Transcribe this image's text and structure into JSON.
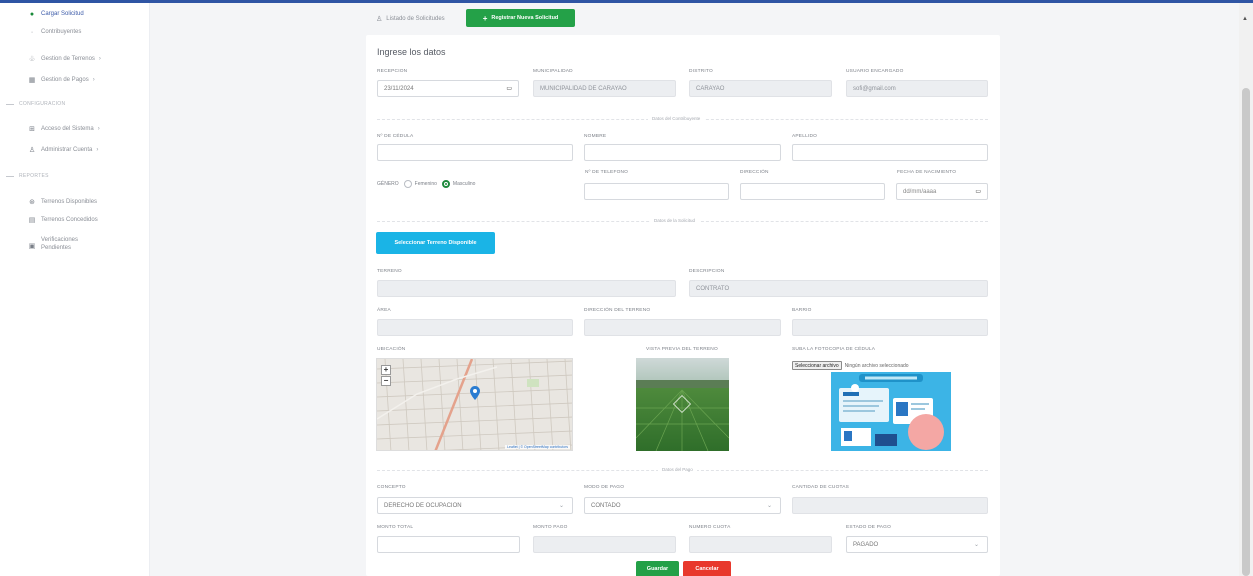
{
  "sidebar": {
    "items": [
      {
        "label": "Cargar Solicitud",
        "icon": "dot-icon"
      },
      {
        "label": "Contribuyentes",
        "icon": "dot-icon"
      },
      {
        "label": "Gestion de Terrenos",
        "icon": "tree-icon",
        "arrow": "›"
      },
      {
        "label": "Gestion de Pagos",
        "icon": "card-icon",
        "arrow": "›"
      }
    ],
    "section_config": "CONFIGURACION",
    "config_items": [
      {
        "label": "Acceso del Sistema",
        "icon": "grid-icon",
        "arrow": "›"
      },
      {
        "label": "Administrar Cuenta",
        "icon": "user-icon",
        "arrow": "›"
      }
    ],
    "section_reports": "REPORTES",
    "report_items": [
      {
        "label": "Terrenos Disponibles",
        "icon": "grid-icon"
      },
      {
        "label": "Terrenos Concedidos",
        "icon": "grid-icon"
      },
      {
        "label": "Verificaciones Pendientes",
        "icon": "doc-icon"
      }
    ]
  },
  "tabs": {
    "list_label": "Listado de Solicitudes",
    "new_label": "Registrar Nueva Solicitud"
  },
  "form": {
    "title": "Ingrese los datos",
    "recepcion_label": "RECEPCION",
    "recepcion_value": "23/11/2024",
    "municipalidad_label": "MUNICIPALIDAD",
    "municipalidad_value": "MUNICIPALIDAD DE CARAYAO",
    "distrito_label": "DISTRITO",
    "distrito_value": "CARAYAO",
    "usuario_label": "USUARIO ENCARGADO",
    "usuario_value": "sofi@gmail.com",
    "sec_contribuyente": "Datos del Contribuyente",
    "cedula_label": "Nº DE CÉDULA",
    "nombre_label": "NOMBRE",
    "apellido_label": "APELLIDO",
    "genero_label": "GÉNERO",
    "femenino": "Femenino",
    "masculino": "Masculino",
    "telefono_label": "Nº DE TELEFONO",
    "direccion_label": "DIRECCIÓN",
    "nacimiento_label": "FECHA DE NACIMIENTO",
    "nacimiento_placeholder": "dd/mm/aaaa",
    "sec_solicitud": "Datos de la Solicitud",
    "select_terreno": "Seleccionar Terreno Disponible",
    "terreno_label": "TERRENO",
    "descripcion_label": "DESCRIPCION",
    "descripcion_value": "CONTRATO",
    "area_label": "ÁREA",
    "direccion_terreno_label": "DIRECCIÓN DEL TERRENO",
    "barrio_label": "BARRIO",
    "ubicacion_label": "UBICACIÓN",
    "vista_label": "VISTA PREVIA DEL TERRENO",
    "foto_label": "SUBA LA FOTOCOPIA DE CÉDULA",
    "file_button": "Seleccionar archivo",
    "file_none": "Ningún archivo seleccionado",
    "map_attrib": "Leaflet | © OpenStreetMap contributors",
    "zoom_in": "+",
    "zoom_out": "−",
    "sec_pago": "Datos del Pago",
    "concepto_label": "CONCEPTO",
    "concepto_value": "DERECHO DE OCUPACION",
    "modo_label": "MODO DE PAGO",
    "modo_value": "CONTADO",
    "cantidad_label": "CANTIDAD DE CUOTAS",
    "monto_total_label": "MONTO TOTAL",
    "monto_pago_label": "MONTO PAGO",
    "numero_cuota_label": "NUMERO CUOTA",
    "estado_label": "ESTADO DE PAGO",
    "estado_value": "PAGADO"
  },
  "buttons": {
    "save": "Guardar",
    "cancel": "Cancelar"
  },
  "colors": {
    "primary_green": "#24a148",
    "cyan": "#1ab4e6",
    "danger": "#e8382c",
    "topbar": "#2f55a4"
  }
}
